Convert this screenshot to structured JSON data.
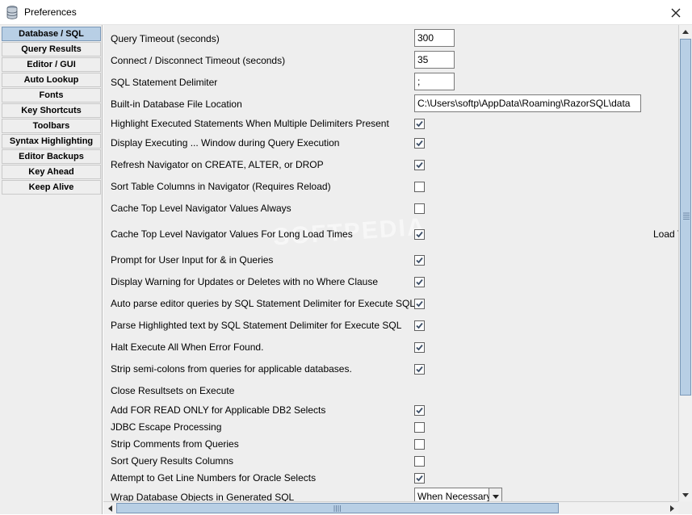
{
  "window": {
    "title": "Preferences"
  },
  "nav": {
    "items": [
      {
        "label": "Database / SQL",
        "selected": true
      },
      {
        "label": "Query Results"
      },
      {
        "label": "Editor / GUI"
      },
      {
        "label": "Auto Lookup"
      },
      {
        "label": "Fonts"
      },
      {
        "label": "Key Shortcuts"
      },
      {
        "label": "Toolbars"
      },
      {
        "label": "Syntax Highlighting"
      },
      {
        "label": "Editor Backups"
      },
      {
        "label": "Key Ahead"
      },
      {
        "label": "Keep Alive"
      }
    ]
  },
  "fields": {
    "query_timeout": {
      "label": "Query Timeout (seconds)",
      "value": "300"
    },
    "connect_timeout": {
      "label": "Connect / Disconnect Timeout (seconds)",
      "value": "35"
    },
    "statement_delimiter": {
      "label": "SQL Statement Delimiter",
      "value": ";"
    },
    "db_file_location": {
      "label": "Built-in Database File Location",
      "value": "C:\\Users\\softp\\AppData\\Roaming\\RazorSQL\\data"
    }
  },
  "options": [
    {
      "label": "Highlight Executed Statements When Multiple Delimiters Present",
      "checked": true
    },
    {
      "label": "Display Executing ... Window during Query Execution",
      "checked": true
    },
    {
      "label": "Refresh Navigator on CREATE, ALTER, or DROP",
      "checked": true
    },
    {
      "label": "Sort Table Columns in Navigator (Requires Reload)",
      "checked": false
    },
    {
      "label": "Cache Top Level Navigator Values Always",
      "checked": false
    },
    {
      "label": "Cache Top Level Navigator Values For Long Load Times",
      "checked": true
    },
    {
      "label": "Prompt for User Input for & in Queries",
      "checked": true
    },
    {
      "label": "Display Warning for Updates or Deletes with no Where Clause",
      "checked": true
    },
    {
      "label": "Auto parse editor queries by SQL Statement Delimiter for Execute SQL",
      "checked": true
    },
    {
      "label": "Parse Highlighted text by SQL Statement Delimiter for Execute SQL",
      "checked": true
    },
    {
      "label": "Halt Execute All When Error Found.",
      "checked": true
    },
    {
      "label": "Strip semi-colons from queries for applicable databases.",
      "checked": true
    },
    {
      "label": "Close Resultsets on Execute",
      "checked": null
    },
    {
      "label": "Add FOR READ ONLY for Applicable DB2 Selects",
      "checked": true
    },
    {
      "label": "JDBC Escape Processing",
      "checked": false
    },
    {
      "label": "Strip Comments from Queries",
      "checked": false
    },
    {
      "label": "Sort Query Results Columns",
      "checked": false
    },
    {
      "label": "Attempt to Get Line Numbers for Oracle Selects",
      "checked": true
    }
  ],
  "wrap_objects": {
    "label": "Wrap Database Objects in Generated SQL",
    "value": "When Necessary"
  },
  "side_text": "Load T",
  "watermark": "SOFTPEDIA",
  "icons": {
    "app": "database-icon",
    "close": "close-icon",
    "check": "checkmark-icon",
    "dropdown": "chevron-down-icon"
  },
  "colors": {
    "selected_nav": "#b8cfe5",
    "panel": "#eeeeee",
    "scroll_thumb": "#b8cfe5"
  }
}
